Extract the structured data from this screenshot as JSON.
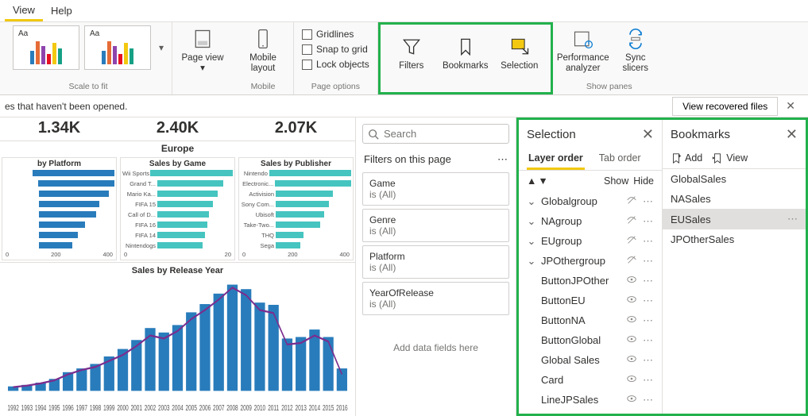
{
  "menu": {
    "view": "View",
    "help": "Help"
  },
  "ribbon": {
    "scale_label": "Scale to fit",
    "mobile_label": "Mobile",
    "pageopt_label": "Page options",
    "show_label": "Show panes",
    "page_view": "Page\nview",
    "mobile_layout": "Mobile\nlayout",
    "filters": "Filters",
    "bookmarks": "Bookmarks",
    "selection": "Selection",
    "perf": "Performance\nanalyzer",
    "sync": "Sync\nslicers",
    "gridlines": "Gridlines",
    "snap": "Snap to grid",
    "lock": "Lock objects",
    "thumb_lbl": "Aa"
  },
  "infobar": {
    "msg": "es that haven't been opened.",
    "recover": "View recovered files"
  },
  "canvas": {
    "kpi": [
      "1.34K",
      "2.40K",
      "2.07K"
    ],
    "region": "Europe",
    "charts": [
      {
        "title": "by Platform",
        "color": "#297cbb",
        "labels": [
          "",
          "",
          "",
          "",
          "",
          "",
          "",
          ""
        ],
        "vals": [
          90,
          72,
          63,
          55,
          52,
          42,
          35,
          30
        ],
        "axis": [
          "0",
          "200",
          "400"
        ]
      },
      {
        "title": "Sales by Game",
        "color": "#46c4c0",
        "labels": [
          "Wii Sports",
          "Grand T...",
          "Mario Ka...",
          "FIFA 15",
          "Call of D...",
          "FIFA 16",
          "FIFA 14",
          "Nintendogs"
        ],
        "vals": [
          95,
          60,
          55,
          50,
          47,
          45,
          43,
          41
        ],
        "axis": [
          "0",
          "20"
        ]
      },
      {
        "title": "Sales by Publisher",
        "color": "#46c4c0",
        "labels": [
          "Nintendo",
          "Electronic...",
          "Activision",
          "Sony Com...",
          "Ubisoft",
          "Take-Two...",
          "THQ",
          "Sega"
        ],
        "vals": [
          92,
          70,
          52,
          48,
          44,
          40,
          25,
          22
        ],
        "axis": [
          "0",
          "200",
          "400"
        ]
      }
    ],
    "linetitle": "Sales by Release Year",
    "years": [
      "1992",
      "1993",
      "1994",
      "1995",
      "1996",
      "1997",
      "1998",
      "1999",
      "2000",
      "2001",
      "2002",
      "2003",
      "2004",
      "2005",
      "2006",
      "2007",
      "2008",
      "2009",
      "2010",
      "2011",
      "2012",
      "2013",
      "2014",
      "2015",
      "2016"
    ]
  },
  "filters_pane": {
    "search_placeholder": "Search",
    "section": "Filters on this page",
    "cards": [
      {
        "name": "Game",
        "val": "is (All)"
      },
      {
        "name": "Genre",
        "val": "is (All)"
      },
      {
        "name": "Platform",
        "val": "is (All)"
      },
      {
        "name": "YearOfRelease",
        "val": "is (All)"
      }
    ],
    "add_hint": "Add data fields here"
  },
  "selection": {
    "title": "Selection",
    "tab_layer": "Layer order",
    "tab_taborder": "Tab order",
    "show": "Show",
    "hide": "Hide",
    "items": [
      {
        "name": "Globalgroup",
        "group": true,
        "hidden": true
      },
      {
        "name": "NAgroup",
        "group": true,
        "hidden": true
      },
      {
        "name": "EUgroup",
        "group": true,
        "hidden": true
      },
      {
        "name": "JPOthergroup",
        "group": true,
        "hidden": true
      },
      {
        "name": "ButtonJPOther",
        "group": false,
        "hidden": false
      },
      {
        "name": "ButtonEU",
        "group": false,
        "hidden": false
      },
      {
        "name": "ButtonNA",
        "group": false,
        "hidden": false
      },
      {
        "name": "ButtonGlobal",
        "group": false,
        "hidden": false
      },
      {
        "name": "Global Sales",
        "group": false,
        "hidden": false
      },
      {
        "name": "Card",
        "group": false,
        "hidden": false
      },
      {
        "name": "LineJPSales",
        "group": false,
        "hidden": false
      }
    ]
  },
  "bookmarks": {
    "title": "Bookmarks",
    "add": "Add",
    "view": "View",
    "items": [
      "GlobalSales",
      "NASales",
      "EUSales",
      "JPOtherSales"
    ],
    "selected": "EUSales"
  },
  "chart_data": [
    {
      "type": "bar",
      "title": "by Platform",
      "orientation": "horizontal",
      "xlabel": "",
      "ylabel": "",
      "categories": [
        "",
        "",
        "",
        "",
        "",
        "",
        "",
        ""
      ],
      "values": [
        380,
        300,
        260,
        230,
        215,
        175,
        145,
        125
      ],
      "xlim": [
        0,
        400
      ]
    },
    {
      "type": "bar",
      "title": "Sales by Game",
      "orientation": "horizontal",
      "categories": [
        "Wii Sports",
        "Grand T...",
        "Mario Ka...",
        "FIFA 15",
        "Call of D...",
        "FIFA 16",
        "FIFA 14",
        "Nintendogs"
      ],
      "values": [
        28,
        17,
        16,
        14.5,
        14,
        13.5,
        13,
        12.5
      ],
      "xlim": [
        0,
        30
      ]
    },
    {
      "type": "bar",
      "title": "Sales by Publisher",
      "orientation": "horizontal",
      "categories": [
        "Nintendo",
        "Electronic...",
        "Activision",
        "Sony Com...",
        "Ubisoft",
        "Take-Two...",
        "THQ",
        "Sega"
      ],
      "values": [
        420,
        310,
        235,
        215,
        200,
        180,
        110,
        100
      ],
      "xlim": [
        0,
        500
      ]
    },
    {
      "type": "line",
      "title": "Sales by Release Year",
      "x": [
        1992,
        1993,
        1994,
        1995,
        1996,
        1997,
        1998,
        1999,
        2000,
        2001,
        2002,
        2003,
        2004,
        2005,
        2006,
        2007,
        2008,
        2009,
        2010,
        2011,
        2012,
        2013,
        2014,
        2015,
        2016
      ],
      "series": [
        {
          "name": "bars",
          "values": [
            6,
            8,
            11,
            16,
            25,
            30,
            36,
            46,
            56,
            68,
            84,
            78,
            88,
            105,
            116,
            130,
            142,
            136,
            118,
            115,
            70,
            72,
            82,
            72,
            30
          ]
        },
        {
          "name": "line",
          "values": [
            5,
            7,
            10,
            14,
            22,
            28,
            32,
            40,
            48,
            60,
            74,
            70,
            80,
            96,
            108,
            122,
            138,
            128,
            108,
            104,
            62,
            64,
            74,
            66,
            22
          ]
        }
      ],
      "ylim": [
        0,
        150
      ]
    }
  ]
}
